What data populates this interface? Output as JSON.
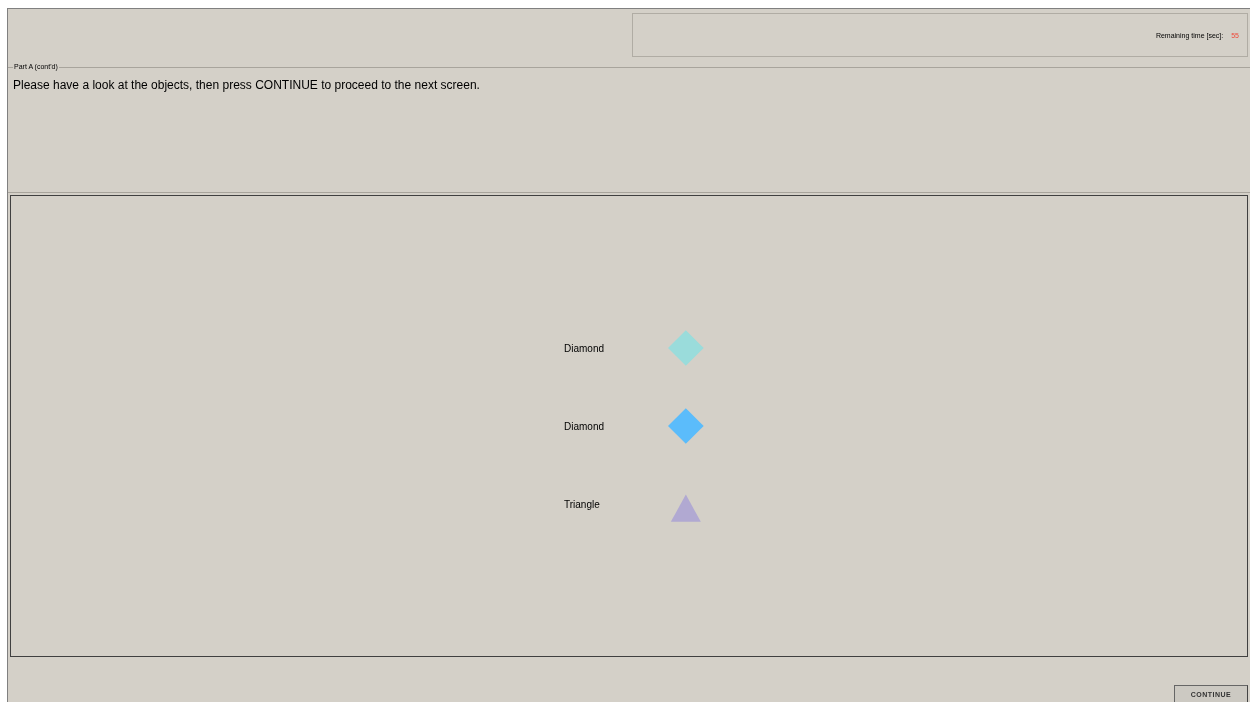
{
  "timer": {
    "label": "Remaining time [sec]:",
    "value": "55"
  },
  "instructions": {
    "legend": "Part A (cont'd)",
    "text": "Please have a look at the objects, then press CONTINUE to proceed to the next screen."
  },
  "objects": [
    {
      "label": "Diamond",
      "kind": "diamond",
      "color": "#9adcdb"
    },
    {
      "label": "Diamond",
      "kind": "diamond",
      "color": "#5bbcfb"
    },
    {
      "label": "Triangle",
      "kind": "triangle",
      "color": "#b1a9d2"
    }
  ],
  "buttons": [
    "CONTINUE"
  ]
}
